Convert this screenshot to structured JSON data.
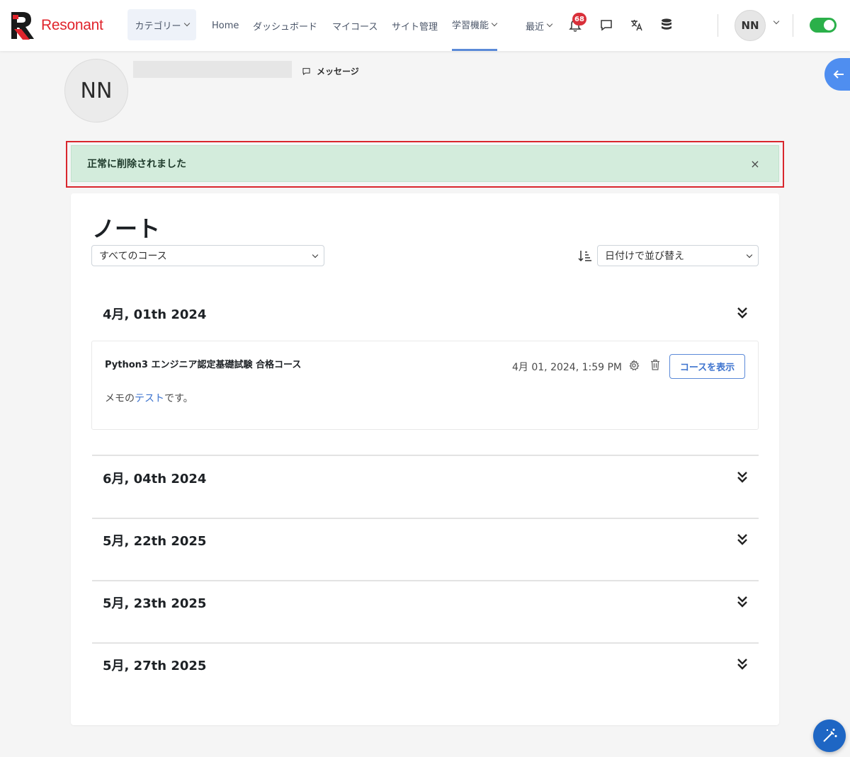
{
  "brand": {
    "name": "Resonant",
    "color": "#e0242c"
  },
  "nav": {
    "categories": "カテゴリー",
    "home": "Home",
    "dashboard": "ダッシュボード",
    "my_courses": "マイコース",
    "site_admin": "サイト管理",
    "learning": "学習機能",
    "recent": "最近",
    "notification_count": "68",
    "icons": [
      "bell-icon",
      "message-icon",
      "translate-icon",
      "database-icon"
    ]
  },
  "user": {
    "initials": "NN"
  },
  "profile": {
    "message_label": "メッセージ"
  },
  "alert": {
    "text": "正常に削除されました",
    "close": "×",
    "color": "#d3ecdc"
  },
  "page": {
    "title": "ノート",
    "course_filter": "すべてのコース",
    "sort_filter": "日付けで並び替え"
  },
  "groups": [
    {
      "date": "4月, 01th 2024"
    },
    {
      "date": "6月, 04th 2024"
    },
    {
      "date": "5月, 22th 2025"
    },
    {
      "date": "5月, 23th 2025"
    },
    {
      "date": "5月, 27th 2025"
    }
  ],
  "note": {
    "course": "Python3 エンジニア認定基礎試験 合格コース",
    "timestamp": "4月 01, 2024, 1:59 PM",
    "button": "コースを表示",
    "body_prefix": "メモの",
    "body_link": "テスト",
    "body_suffix": "です。"
  },
  "colors": {
    "accent": "#3e74cf",
    "toggle": "#2bb04a",
    "badge": "#d9303a"
  }
}
